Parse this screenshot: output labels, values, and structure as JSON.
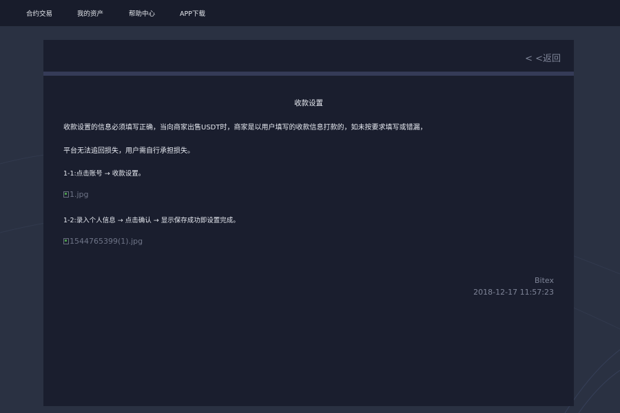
{
  "nav": {
    "items": [
      {
        "label": "合约交易"
      },
      {
        "label": "我的资产"
      },
      {
        "label": "帮助中心"
      },
      {
        "label": "APP下载"
      }
    ]
  },
  "header": {
    "back_label": "< <返回"
  },
  "article": {
    "title": "收款设置",
    "paragraphs": [
      "收款设置的信息必须填写正确，当向商家出售USDT时，商家是以用户填写的收款信息打款的，如未按要求填写或错漏，",
      "平台无法追回损失，用户需自行承担损失。"
    ],
    "step1": "1-1:点击账号  →  收款设置。",
    "image1_alt": "1.jpg",
    "step2": "1-2:录入个人信息  →  点击确认  →  显示保存成功即设置完成。",
    "image2_alt": "1544765399(1).jpg",
    "author": "Bitex",
    "datetime": "2018-12-17 11:57:23"
  },
  "colors": {
    "background": "#2a3142",
    "topbar": "#181c2b",
    "panel": "#1a1e2e",
    "divider": "#353b57",
    "muted_text": "#7f8598"
  }
}
